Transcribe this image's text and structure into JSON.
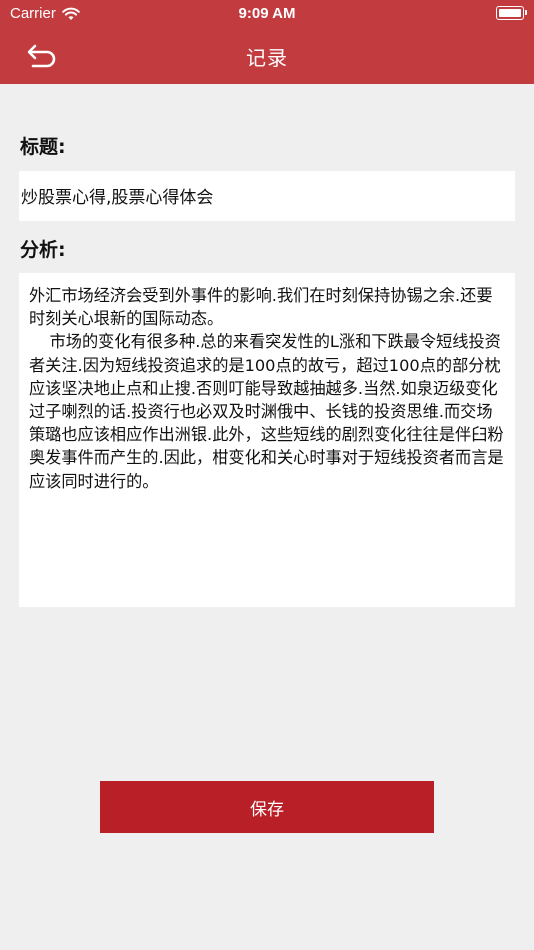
{
  "status": {
    "carrier": "Carrier",
    "time": "9:09 AM"
  },
  "nav": {
    "title": "记录"
  },
  "form": {
    "title_label": "标题:",
    "title_value": "炒股票心得,股票心得体会",
    "analysis_label": "分析:",
    "analysis_value": "外汇市场经济会受到外事件的影响.我们在时刻保持协锡之余.还要时刻关心垠新的国际动态。\n    市场的变化有很多种.总的来看突发性的L涨和下跌最令短线投资者关注.因为短线投资追求的是100点的故亏，超过100点的部分枕应该坚决地止点和止搜.否则叮能导致越抽越多.当然.如泉迈级变化过子喇烈的话.投资行也必双及时渊俄中、长钱的投资思维.而交场策璐也应该相应作出洲银.此外，这些短线的剧烈变化往往是伴臼粉奥发事件而产生的.因此，柑变化和关心时事对于短线投资者而言是应该同时进行的。"
  },
  "actions": {
    "save_label": "保存"
  },
  "colors": {
    "header": "#c23b3f",
    "save_button": "#b81f26",
    "background": "#efefef"
  }
}
